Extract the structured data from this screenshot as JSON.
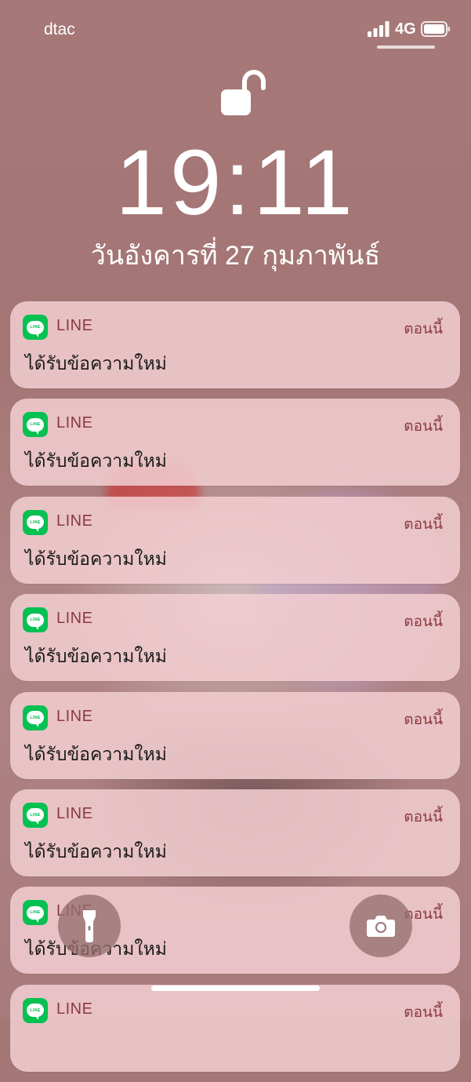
{
  "status_bar": {
    "carrier": "dtac",
    "network": "4G",
    "signal_icon": "signal-bars-icon",
    "battery_icon": "battery-icon"
  },
  "lock_screen": {
    "lock_icon": "unlocked-padlock-icon",
    "time": "19:11",
    "date": "วันอังคารที่ 27 กุมภาพันธ์"
  },
  "notifications": [
    {
      "app": "LINE",
      "time": "ตอนนี้",
      "message": "ได้รับข้อความใหม่"
    },
    {
      "app": "LINE",
      "time": "ตอนนี้",
      "message": "ได้รับข้อความใหม่"
    },
    {
      "app": "LINE",
      "time": "ตอนนี้",
      "message": "ได้รับข้อความใหม่"
    },
    {
      "app": "LINE",
      "time": "ตอนนี้",
      "message": "ได้รับข้อความใหม่"
    },
    {
      "app": "LINE",
      "time": "ตอนนี้",
      "message": "ได้รับข้อความใหม่"
    },
    {
      "app": "LINE",
      "time": "ตอนนี้",
      "message": "ได้รับข้อความใหม่"
    },
    {
      "app": "LINE",
      "time": "ตอนนี้",
      "message": "ได้รับข้อความใหม่"
    },
    {
      "app": "LINE",
      "time": "ตอนนี้",
      "message": ""
    }
  ],
  "app_icon_text": "LINE",
  "controls": {
    "flashlight_icon": "flashlight-icon",
    "camera_icon": "camera-icon"
  },
  "colors": {
    "line_green": "#06c152",
    "accent_text": "#8c3a3f",
    "card_background": "#f2ced2"
  }
}
